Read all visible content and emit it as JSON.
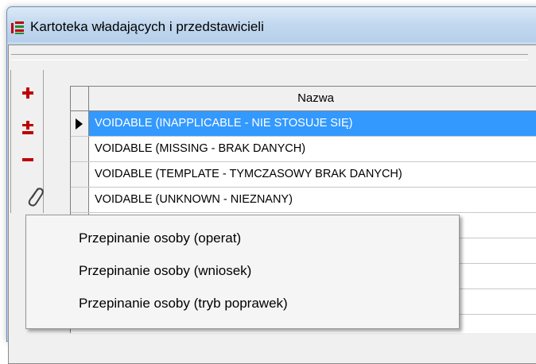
{
  "window": {
    "title": "Kartoteka władających i przedstawicieli"
  },
  "toolbar": {
    "buttons": [
      {
        "name": "add-button",
        "icon": "plus-icon",
        "color": "#c00000"
      },
      {
        "name": "add-remove-button",
        "icon": "plus-minus-icon",
        "color": "#c00000"
      },
      {
        "name": "remove-button",
        "icon": "minus-icon",
        "color": "#c00000"
      },
      {
        "name": "attach-button",
        "icon": "paperclip-icon",
        "color": "#404040"
      }
    ]
  },
  "grid": {
    "column_header": "Nazwa",
    "rows": [
      {
        "label": "VOIDABLE (INAPPLICABLE - NIE STOSUJE SIĘ)",
        "selected": true
      },
      {
        "label": "VOIDABLE (MISSING - BRAK DANYCH)",
        "selected": false
      },
      {
        "label": "VOIDABLE (TEMPLATE - TYMCZASOWY BRAK DANYCH)",
        "selected": false
      },
      {
        "label": "VOIDABLE (UNKNOWN - NIEZNANY)",
        "selected": false
      }
    ],
    "selection_color": "#3399ff"
  },
  "context_menu": {
    "items": [
      "Przepinanie osoby (operat)",
      "Przepinanie osoby (wniosek)",
      "Przepinanie osoby (tryb poprawek)"
    ]
  }
}
